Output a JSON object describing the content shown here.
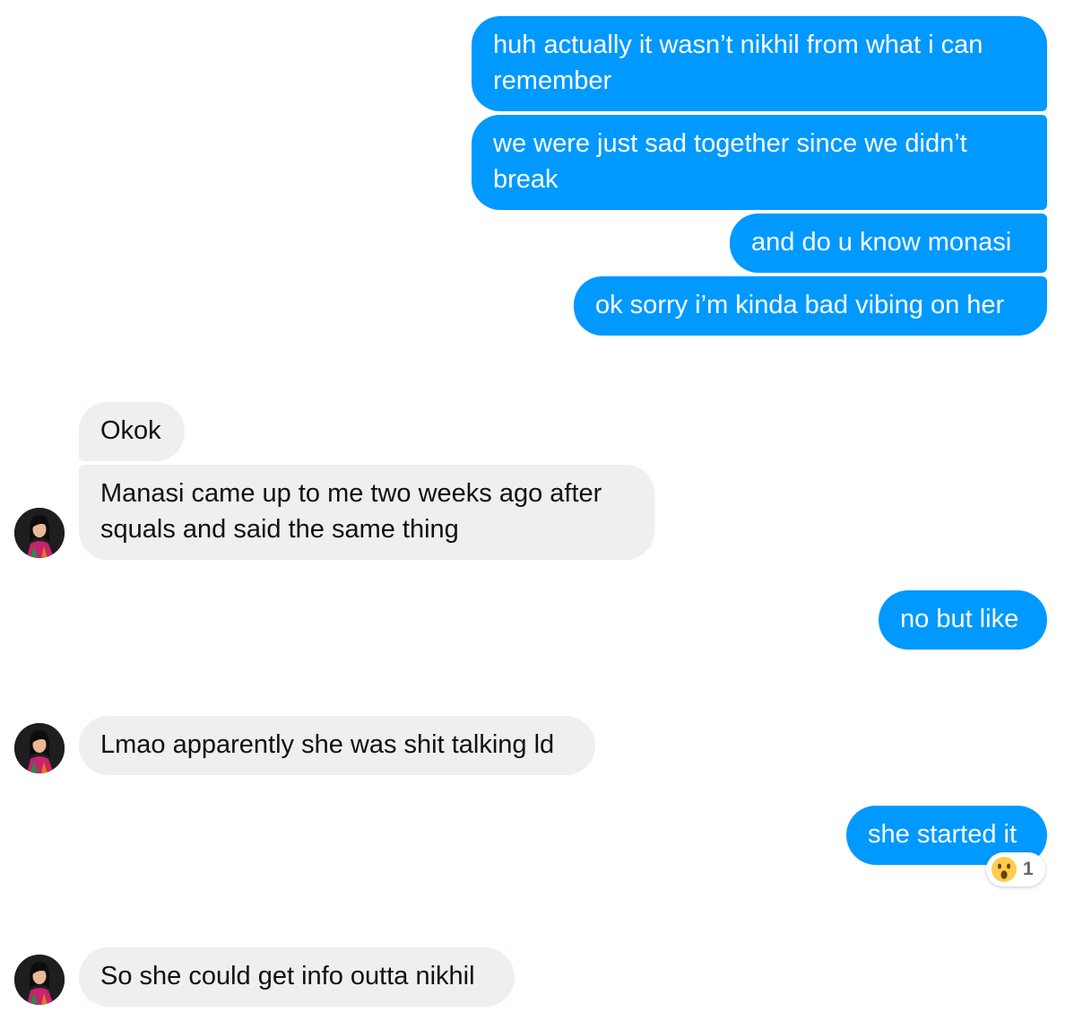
{
  "messages": [
    {
      "text": "huh actually it wasn’t nikhil from what i can\nremember"
    },
    {
      "text": "we were just sad together since we didn’t\nbreak"
    },
    {
      "text": "and do u know monasi"
    },
    {
      "text": "ok sorry i’m kinda bad vibing on her"
    },
    {
      "text": "Okok"
    },
    {
      "text": "Manasi came up to me two weeks ago after\nsquals and said the same thing"
    },
    {
      "text": "no but like"
    },
    {
      "text": "Lmao apparently she was shit talking ld"
    },
    {
      "text": "she started it",
      "reaction": {
        "icon": "surprised-face-emoji",
        "count": "1"
      }
    },
    {
      "text": "So she could get info outta nikhil"
    }
  ],
  "colors": {
    "outgoing_bubble": "#0099ff",
    "incoming_bubble": "#f0eeef"
  }
}
